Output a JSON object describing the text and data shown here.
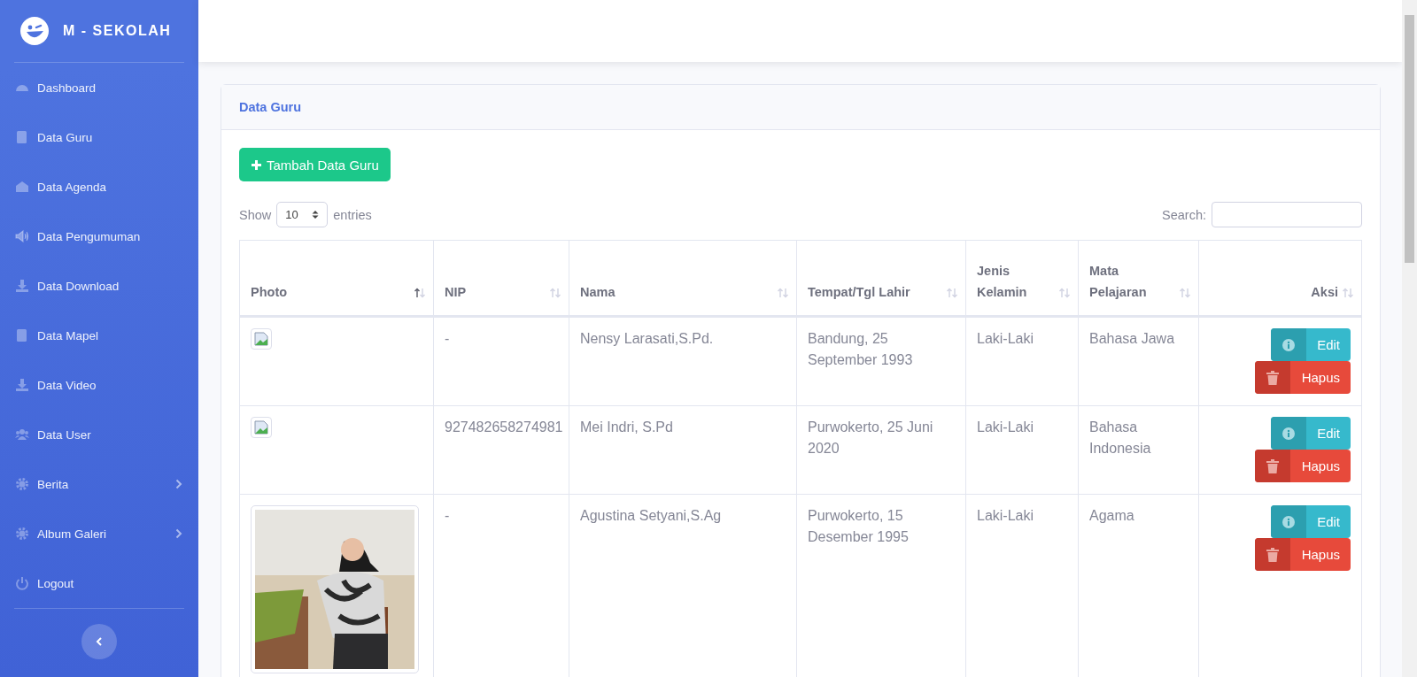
{
  "brand": {
    "title": "M - SEKOLAH"
  },
  "sidebar": {
    "items": [
      {
        "label": "Dashboard",
        "submenu": false
      },
      {
        "label": "Data Guru",
        "submenu": false
      },
      {
        "label": "Data Agenda",
        "submenu": false
      },
      {
        "label": "Data Pengumuman",
        "submenu": false
      },
      {
        "label": "Data Download",
        "submenu": false
      },
      {
        "label": "Data Mapel",
        "submenu": false
      },
      {
        "label": "Data Video",
        "submenu": false
      },
      {
        "label": "Data User",
        "submenu": false
      },
      {
        "label": "Berita",
        "submenu": true
      },
      {
        "label": "Album Galeri",
        "submenu": true
      },
      {
        "label": "Logout",
        "submenu": false
      }
    ]
  },
  "card": {
    "title": "Data Guru",
    "add_button": "Tambah Data Guru",
    "show_label": "Show",
    "page_size": "10",
    "entries_label": "entries",
    "search_label": "Search:",
    "table": {
      "columns": [
        {
          "label": "Photo",
          "sorted": true
        },
        {
          "label": "NIP",
          "sorted": false
        },
        {
          "label": "Nama",
          "sorted": false
        },
        {
          "label": "Tempat/Tgl Lahir",
          "sorted": false
        },
        {
          "label": "Jenis Kelamin",
          "sorted": false
        },
        {
          "label": "Mata Pelajaran",
          "sorted": false
        },
        {
          "label": "Aksi",
          "sorted": false
        }
      ],
      "rows": [
        {
          "photo": {
            "kind": "broken"
          },
          "nip": "-",
          "nama": "Nensy Larasati,S.Pd.",
          "ttl": "Bandung, 25 September 1993",
          "jenis_kelamin": "Laki-Laki",
          "mapel": "Bahasa Jawa",
          "edit": "Edit",
          "hapus": "Hapus"
        },
        {
          "photo": {
            "kind": "broken"
          },
          "nip": "927482658274981",
          "nama": "Mei Indri, S.Pd",
          "ttl": "Purwokerto, 25 Juni 2020",
          "jenis_kelamin": "Laki-Laki",
          "mapel": "Bahasa Indonesia",
          "edit": "Edit",
          "hapus": "Hapus"
        },
        {
          "nip": "-",
          "nama": "Agustina Setyani,S.Ag",
          "ttl": "Purwokerto, 15 Desember 1995",
          "jenis_kelamin": "Laki-Laki",
          "mapel": "Agama",
          "edit": "Edit",
          "hapus": "Hapus"
        }
      ]
    }
  }
}
